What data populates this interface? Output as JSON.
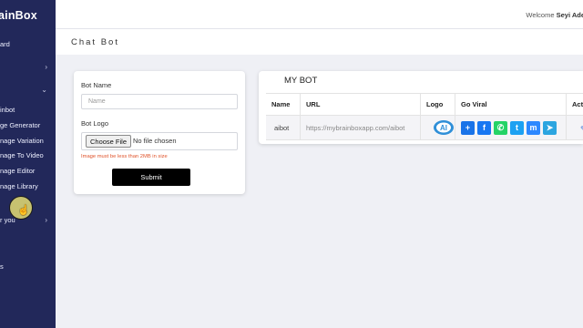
{
  "sidebar": {
    "brand": "ainBox",
    "items": [
      {
        "label": "ard",
        "chevron": false
      },
      {
        "label": "",
        "chevron": true
      },
      {
        "label": "",
        "chevron": true,
        "expanded": true
      },
      {
        "label": "inbot",
        "chevron": false
      },
      {
        "label": "ge Generator",
        "chevron": false
      },
      {
        "label": "nage Variation",
        "chevron": false
      },
      {
        "label": "nage To Video",
        "chevron": false
      },
      {
        "label": "nage Editor",
        "chevron": false
      },
      {
        "label": "nage Library",
        "chevron": false
      },
      {
        "label": "r you",
        "chevron": true
      },
      {
        "label": "",
        "chevron": false
      },
      {
        "label": "s",
        "chevron": false
      },
      {
        "label": "",
        "chevron": false
      }
    ]
  },
  "header": {
    "welcome": "Welcome",
    "user": "Seyi Ade"
  },
  "page": {
    "title": "Chat Bot"
  },
  "form": {
    "bot_name_label": "Bot Name",
    "bot_name_placeholder": "Name",
    "bot_logo_label": "Bot Logo",
    "file_button": "Choose File",
    "file_status": "No file chosen",
    "hint": "Image must be less than 2MB in size",
    "submit": "Submit"
  },
  "table": {
    "title": "MY BOT",
    "columns": [
      "Name",
      "URL",
      "Logo",
      "Go Viral",
      "Acti"
    ],
    "rows": [
      {
        "name": "aibot",
        "url": "https://mybrainboxapp.com/aibot",
        "logo_text": "AI"
      }
    ],
    "share_icons": [
      {
        "name": "share-plus-icon",
        "glyph": "+",
        "color": "#1a73e8"
      },
      {
        "name": "facebook-icon",
        "glyph": "f",
        "color": "#1877f2"
      },
      {
        "name": "whatsapp-icon",
        "glyph": "✆",
        "color": "#25d366"
      },
      {
        "name": "twitter-icon",
        "glyph": "t",
        "color": "#1da1f2"
      },
      {
        "name": "messenger-icon",
        "glyph": "m",
        "color": "#2d88ff"
      },
      {
        "name": "telegram-icon",
        "glyph": "➤",
        "color": "#2ca5e0"
      }
    ]
  }
}
